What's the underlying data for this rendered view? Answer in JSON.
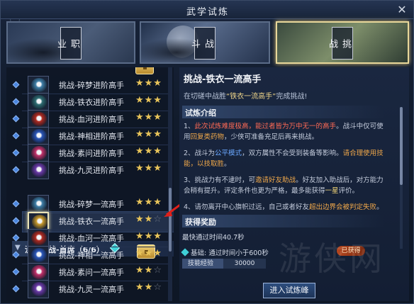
{
  "window": {
    "title": "武学试炼",
    "close": "✕"
  },
  "banners": [
    {
      "label_top": "职",
      "label_bottom": "业"
    },
    {
      "label_top": "战",
      "label_bottom": "斗"
    },
    {
      "label_top": "挑",
      "label_bottom": "战"
    }
  ],
  "list_top": [
    {
      "label": "挑战-碎梦进阶高手",
      "stars": "★★★",
      "empty": "",
      "color": "#3f7fa8"
    },
    {
      "label": "挑战-铁衣进阶高手",
      "stars": "★★★",
      "empty": "",
      "color": "#2e6d72"
    },
    {
      "label": "挑战-血河进阶高手",
      "stars": "★★★",
      "empty": "",
      "color": "#b02a20"
    },
    {
      "label": "挑战-神相进阶高手",
      "stars": "★★★",
      "empty": "",
      "color": "#2a56b8"
    },
    {
      "label": "挑战-素问进阶高手",
      "stars": "★★★",
      "empty": "",
      "color": "#c2306a"
    },
    {
      "label": "挑战-九灵进阶高手",
      "stars": "★★★",
      "empty": "",
      "color": "#6b3aa8"
    }
  ],
  "section": {
    "arrow": "▼",
    "title": "流派挑战-首席（6/6）"
  },
  "list_bottom": [
    {
      "label": "挑战-碎梦一流高手",
      "stars": "★★★",
      "empty": "",
      "color": "#3f7fa8"
    },
    {
      "label": "挑战-铁衣一流高手",
      "stars": "★★",
      "empty": "☆",
      "color": "#c89a2c"
    },
    {
      "label": "挑战-血河一流高手",
      "stars": "★★★",
      "empty": "",
      "color": "#b02a20"
    },
    {
      "label": "挑战-神相一流高手",
      "stars": "★★★",
      "empty": "",
      "color": "#2a56b8"
    },
    {
      "label": "挑战-素问一流高手",
      "stars": "★★",
      "empty": "☆",
      "color": "#c2306a"
    },
    {
      "label": "挑战-九灵一流高手",
      "stars": "★★",
      "empty": "☆",
      "color": "#6b3aa8"
    }
  ],
  "detail": {
    "title": "挑战-铁衣一流高手",
    "subtitle_pre": "在切磋中战胜",
    "subtitle_hl": "“铁衣一流高手”",
    "subtitle_post": "完成挑战!",
    "intro_header": "试炼介绍",
    "p1_a": "1、",
    "p1_red": "此次试炼难度极高，能过者皆为万中无一的高手",
    "p1_b": "。战斗中仅可使用",
    "p1_orange": "回复类药物",
    "p1_c": "，少侠可准备充足后再来挑战。",
    "p2_a": "2、战斗为",
    "p2_blue": "公平模式",
    "p2_b": "，双方属性不会受到装备等影响。",
    "p2_orange": "请合理使用技能，以技取胜",
    "p2_c": "。",
    "p3_a": "3、挑战力有不逮时，可",
    "p3_orange": "邀请好友助战",
    "p3_b": "。好友加入助战后，对方能力会稍有提升。评定条件也更为严格，最多能获得",
    "p3_yellow": "一星",
    "p3_c": "评价。",
    "p4_a": "4、请勿离开中心旗帜过远，自己或者好友",
    "p4_orange": "超出边界会被判定失败",
    "p4_b": "。",
    "reward_header": "获得奖励",
    "best_time": "最快通过时间40.7秒",
    "basic_label": "基础:  通过时间小于600秒",
    "got": "已获得",
    "exp_key": "技能经验",
    "exp_val": "30000",
    "enter_button": "进入试炼峰"
  },
  "watermark": "游侠网"
}
